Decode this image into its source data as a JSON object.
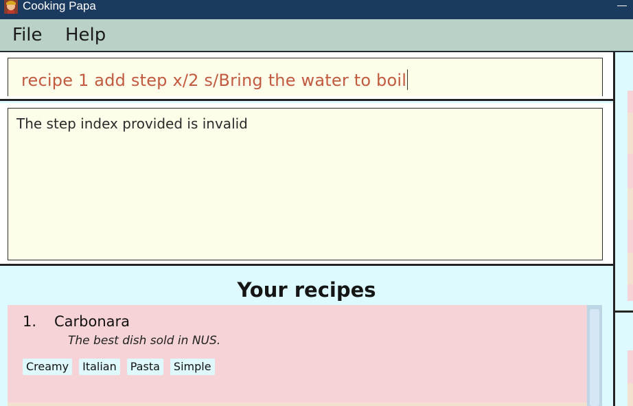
{
  "window": {
    "title": "Cooking Papa"
  },
  "menu": {
    "file": "File",
    "help": "Help"
  },
  "command": {
    "value": "recipe 1 add step x/2 s/Bring the water to boil"
  },
  "result": {
    "message": "The step index provided is invalid"
  },
  "recipes": {
    "heading": "Your recipes",
    "items": [
      {
        "index": "1.",
        "name": "Carbonara",
        "description": "The best dish sold in NUS.",
        "tags": [
          "Creamy",
          "Italian",
          "Pasta",
          "Simple"
        ]
      }
    ]
  },
  "colors": {
    "titlebar": "#1b3a60",
    "menubar": "#b9d1c6",
    "command_text": "#c25a40",
    "card": "#f6d3d6",
    "tag": "#dff8fb",
    "panel": "#dcfaff"
  }
}
